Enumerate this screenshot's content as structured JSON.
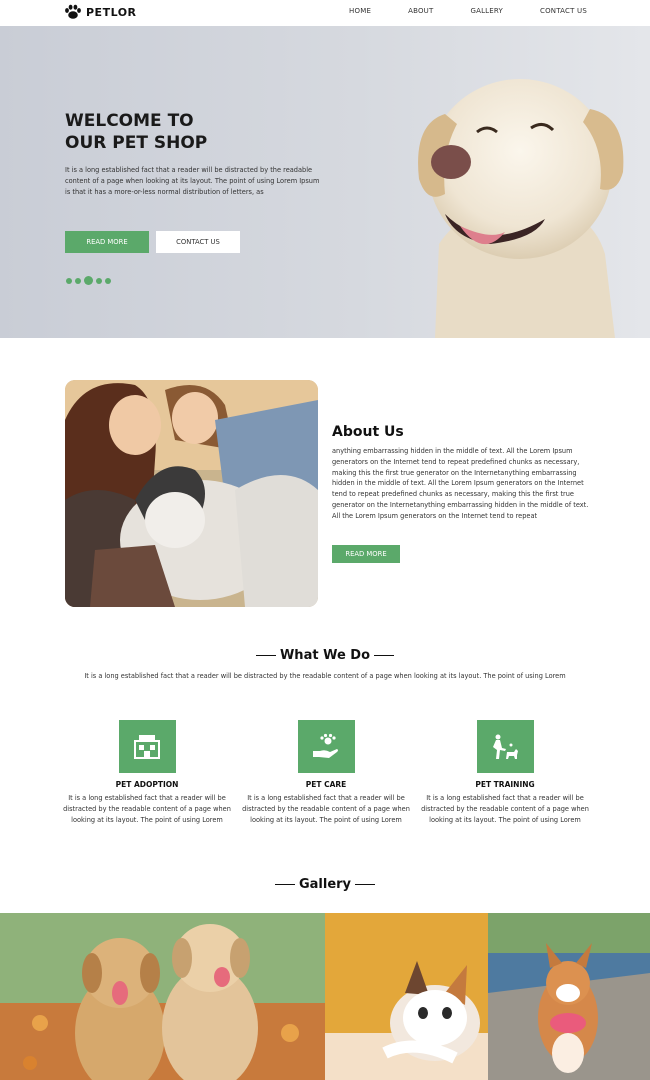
{
  "nav": {
    "logo_text": "PETLOR",
    "links": [
      "HOME",
      "ABOUT",
      "GALLERY",
      "CONTACT US"
    ]
  },
  "hero": {
    "title_line1": "WELCOME TO",
    "title_line2": "OUR PET SHOP",
    "description": "It is a long established fact that a reader will be distracted by the readable content of a page when looking at its layout. The point of using Lorem Ipsum is that it has a more-or-less normal distribution of letters, as",
    "read_more_label": "READ MORE",
    "contact_label": "CONTACT US",
    "slide_count": 5,
    "active_slide": 3
  },
  "about": {
    "title": "About Us",
    "text": "anything embarrassing hidden in the middle of text. All the Lorem Ipsum generators on the Internet tend to repeat predefined chunks as necessary, making this the first true generator on the Internetanything embarrassing hidden in the middle of text. All the Lorem Ipsum generators on the Internet tend to repeat predefined chunks as necessary, making this the first true generator on the Internetanything embarrassing hidden in the middle of text. All the Lorem Ipsum generators on the Internet tend to repeat",
    "button_label": "READ MORE"
  },
  "what_we_do": {
    "title": "What We Do",
    "description": "It is a long established fact that a reader will be distracted by the readable content of a page when looking at its layout. The point of using Lorem",
    "services": [
      {
        "title": "PET ADOPTION",
        "icon": "pet-house-icon",
        "text": "It is a long established fact that a reader will be distracted by the readable content of a page when looking at its layout. The point of using Lorem"
      },
      {
        "title": "PET CARE",
        "icon": "hand-paw-icon",
        "text": "It is a long established fact that a reader will be distracted by the readable content of a page when looking at its layout. The point of using Lorem"
      },
      {
        "title": "PET TRAINING",
        "icon": "dog-training-icon",
        "text": "It is a long established fact that a reader will be distracted by the readable content of a page when looking at its layout. The point of using Lorem"
      }
    ]
  },
  "gallery": {
    "title": "Gallery"
  },
  "colors": {
    "accent": "#5ba96a",
    "hero_bg": "#d3d6dc",
    "text_dark": "#111111"
  }
}
